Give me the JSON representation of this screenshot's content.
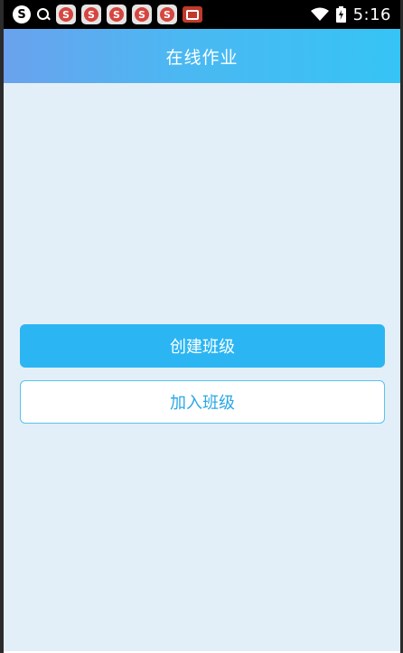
{
  "status_bar": {
    "time": "5:16",
    "left_icons": [
      "sogou-icon",
      "search-icon",
      "app-s-icon",
      "app-s-icon",
      "app-s-icon",
      "app-s-icon",
      "app-s-icon",
      "app-red-icon"
    ],
    "right_icons": [
      "wifi-icon",
      "battery-icon"
    ],
    "sogou_glyph": "S",
    "app_glyph": "S"
  },
  "header": {
    "title": "在线作业"
  },
  "actions": {
    "create_label": "创建班级",
    "join_label": "加入班级"
  },
  "colors": {
    "background": "#e3eff8",
    "header_start": "#6aa2ee",
    "header_end": "#36c4f5",
    "primary": "#2bb6f3",
    "outline_text": "#2aa7e6"
  }
}
